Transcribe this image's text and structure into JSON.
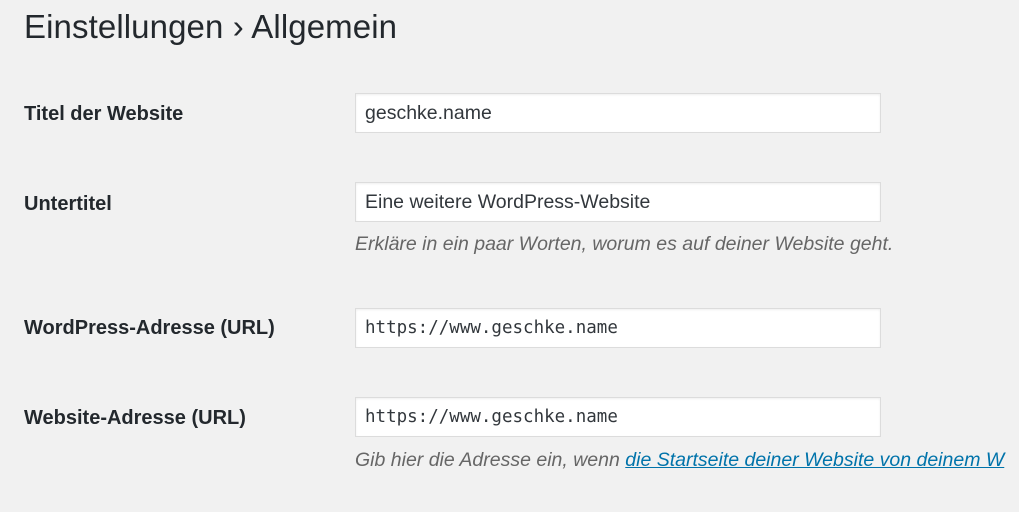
{
  "header": {
    "section": "Einstellungen",
    "separator": "›",
    "page": "Allgemein"
  },
  "fields": {
    "site_title": {
      "label": "Titel der Website",
      "value": "geschke.name"
    },
    "tagline": {
      "label": "Untertitel",
      "value": "Eine weitere WordPress-Website",
      "description": "Erkläre in ein paar Worten, worum es auf deiner Website geht."
    },
    "wp_address": {
      "label": "WordPress-Adresse (URL)",
      "value": "https://www.geschke.name"
    },
    "site_address": {
      "label": "Website-Adresse (URL)",
      "value": "https://www.geschke.name",
      "description_prefix": "Gib hier die Adresse ein, wenn ",
      "description_link": "die Startseite deiner Website von deinem W"
    }
  },
  "colors": {
    "background": "#f1f1f1",
    "text": "#23282d",
    "link": "#0073aa",
    "description": "#666666"
  }
}
